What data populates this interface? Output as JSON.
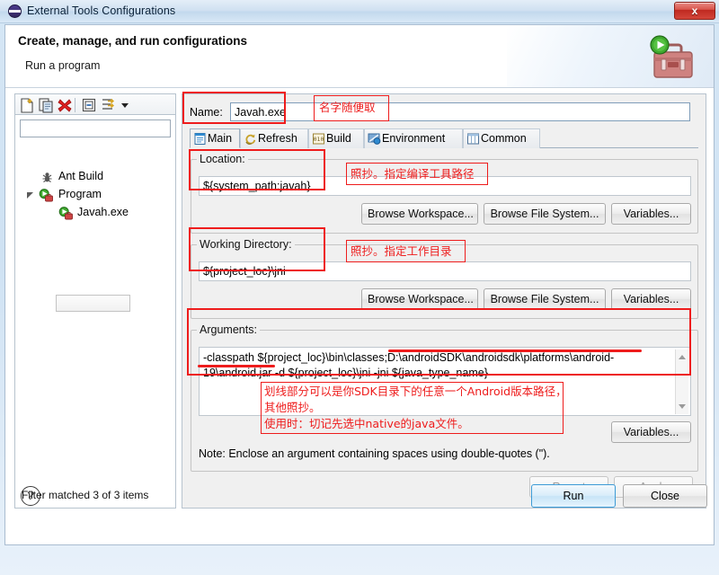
{
  "window": {
    "title": "External Tools Configurations",
    "title_icon": "eclipse-circle-icon",
    "close_label": "x"
  },
  "header": {
    "title": "Create, manage, and run configurations",
    "subtitle": "Run a program",
    "icon": "toolbox-with-run-icon"
  },
  "left": {
    "toolbar": [
      {
        "name": "new-configuration-icon",
        "tooltip": "New launch configuration"
      },
      {
        "name": "duplicate-configuration-icon",
        "tooltip": "Duplicate"
      },
      {
        "name": "delete-configuration-icon",
        "tooltip": "Delete"
      },
      {
        "name": "collapse-all-icon",
        "tooltip": "Collapse All"
      },
      {
        "name": "filter-icon",
        "tooltip": "Filter launch configurations"
      },
      {
        "name": "chevron-down-icon",
        "tooltip": "Menu"
      }
    ],
    "filter_value": "",
    "filter_placeholder": "",
    "tree": [
      {
        "label": "Ant Build",
        "icon": "ant-icon",
        "indent": 0,
        "selected": false,
        "expander": "none"
      },
      {
        "label": "Program",
        "icon": "program-icon",
        "indent": 0,
        "selected": false,
        "expander": "expanded"
      },
      {
        "label": "Javah.exe",
        "icon": "program-icon",
        "indent": 1,
        "selected": true,
        "expander": "none"
      }
    ],
    "status": "Filter matched 3 of 3 items"
  },
  "main": {
    "name_label": "Name:",
    "name_value": "Javah.exe",
    "tabs": [
      {
        "label": "Main",
        "icon": "main-tab-icon",
        "active": true
      },
      {
        "label": "Refresh",
        "icon": "refresh-tab-icon",
        "active": false
      },
      {
        "label": "Build",
        "icon": "build-tab-icon",
        "active": false
      },
      {
        "label": "Environment",
        "icon": "environment-tab-icon",
        "active": false
      },
      {
        "label": "Common",
        "icon": "common-tab-icon",
        "active": false
      }
    ],
    "location": {
      "title": "Location:",
      "value": "${system_path:javah}",
      "buttons": [
        "Browse Workspace...",
        "Browse File System...",
        "Variables..."
      ]
    },
    "working_directory": {
      "title": "Working Directory:",
      "value": "${project_loc}\\jni",
      "buttons": [
        "Browse Workspace...",
        "Browse File System...",
        "Variables..."
      ]
    },
    "arguments": {
      "title": "Arguments:",
      "value": "-classpath ${project_loc}\\bin\\classes;D:\\androidSDK\\androidsdk\\platforms\\android-19\\android.jar -d ${project_loc}\\jni -jni ${java_type_name}",
      "variables_button": "Variables...",
      "note": "Note: Enclose an argument containing spaces using double-quotes (\")."
    }
  },
  "footer": {
    "revert_label": "Revert",
    "apply_label": "Apply",
    "help_label": "?",
    "run_label": "Run",
    "close_label": "Close"
  },
  "annotations": {
    "name_note": "名字随便取",
    "location_note": "照抄。指定编译工具路径",
    "working_dir_note": "照抄。指定工作目录",
    "arguments_note_line1": "划线部分可以是你SDK目录下的任意一个Android版本路径，",
    "arguments_note_line2": "其他照抄。",
    "arguments_note_line3": "使用时：切记先选中native的java文件。",
    "color": "#ee1c1c"
  }
}
